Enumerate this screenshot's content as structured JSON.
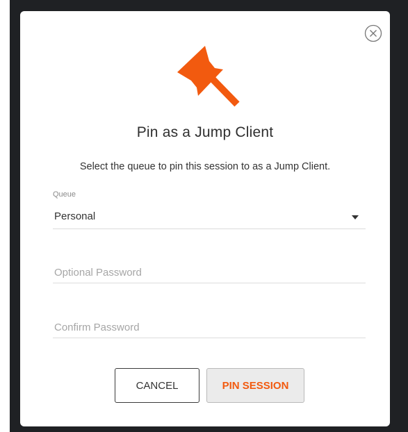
{
  "dialog": {
    "title": "Pin as a Jump Client",
    "subtitle": "Select the queue to pin this session to as a Jump Client.",
    "icon": "pushpin-icon",
    "accent_color": "#f25a0f"
  },
  "queue": {
    "label": "Queue",
    "value": "Personal"
  },
  "password": {
    "placeholder": "Optional Password",
    "value": ""
  },
  "confirm_password": {
    "placeholder": "Confirm Password",
    "value": ""
  },
  "buttons": {
    "cancel_label": "CANCEL",
    "pin_label": "PIN SESSION"
  }
}
